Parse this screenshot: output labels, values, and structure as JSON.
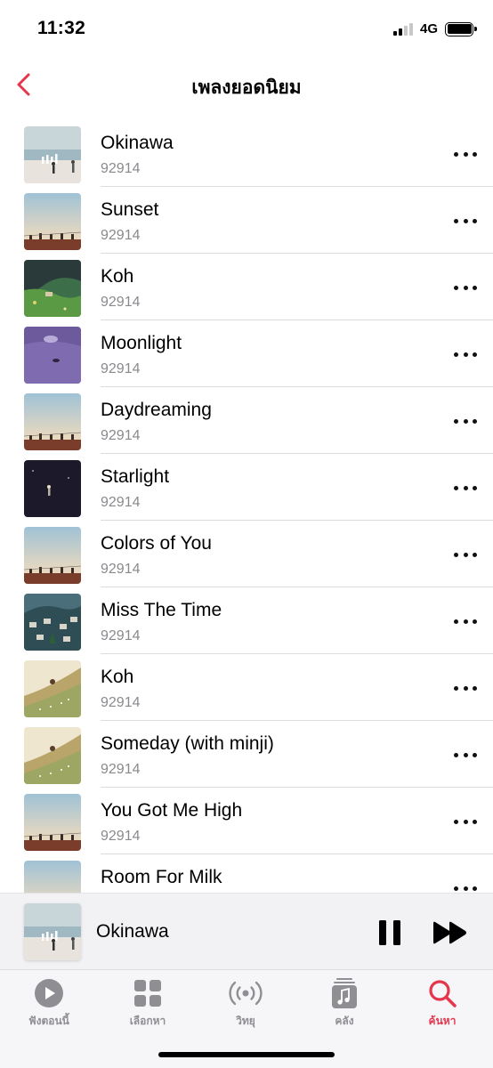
{
  "status_bar": {
    "time": "11:32",
    "network": "4G",
    "signal_bars": 2
  },
  "nav": {
    "title": "เพลงยอดนิยม",
    "back_icon": "chevron-left-icon"
  },
  "colors": {
    "accent": "#e5364c",
    "secondary_text": "#8a8a8e"
  },
  "songs": [
    {
      "title": "Okinawa",
      "artist": "92914",
      "art": "beach"
    },
    {
      "title": "Sunset",
      "artist": "92914",
      "art": "sky"
    },
    {
      "title": "Koh",
      "artist": "92914",
      "art": "forest"
    },
    {
      "title": "Moonlight",
      "artist": "92914",
      "art": "purple"
    },
    {
      "title": "Daydreaming",
      "artist": "92914",
      "art": "sky"
    },
    {
      "title": "Starlight",
      "artist": "92914",
      "art": "night"
    },
    {
      "title": "Colors of You",
      "artist": "92914",
      "art": "sky"
    },
    {
      "title": "Miss The Time",
      "artist": "92914",
      "art": "village"
    },
    {
      "title": "Koh",
      "artist": "92914",
      "art": "hill"
    },
    {
      "title": "Someday (with minji)",
      "artist": "92914",
      "art": "hill"
    },
    {
      "title": "You Got Me High",
      "artist": "92914",
      "art": "sky"
    },
    {
      "title": "Room For Milk",
      "artist": "",
      "art": "sky"
    }
  ],
  "now_playing": {
    "title": "Okinawa",
    "state": "playing"
  },
  "tabs": [
    {
      "label": "ฟังตอนนี้",
      "icon": "play-circle-icon",
      "active": false
    },
    {
      "label": "เลือกหา",
      "icon": "grid-icon",
      "active": false
    },
    {
      "label": "วิทยุ",
      "icon": "radio-icon",
      "active": false
    },
    {
      "label": "คลัง",
      "icon": "music-library-icon",
      "active": false
    },
    {
      "label": "ค้นหา",
      "icon": "search-icon",
      "active": true
    }
  ]
}
